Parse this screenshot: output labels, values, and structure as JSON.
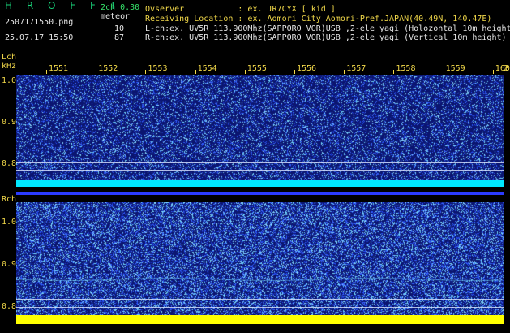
{
  "header": {
    "app_title": "H R O F F T",
    "channel_version": "2ch 0.30",
    "meteor_label": "meteor",
    "filename": "2507171550.png",
    "datetime": "25.07.17 15:50",
    "meteor_count_l": "10",
    "meteor_count_r": "87",
    "observer_line": "Ovserver           : ex. JR7CYX [ kid ]",
    "location_line": "Receiving Location : ex. Aomori City Aomori-Pref.JAPAN(40.49N, 140.47E)",
    "lch_line": "L-ch:ex. UV5R 113.900Mhz(SAPPORO VOR)USB ,2-ele yagi (Holozontal 10m height",
    "rch_line": "R-ch:ex. UV5R 113.900Mhz(SAPPORO VOR)USB ,2-ele yagi (Vertical 10m height)"
  },
  "lch": {
    "label": "Lch",
    "unit": "kHz",
    "yticks": [
      "1.0",
      "0.9",
      "0.8"
    ]
  },
  "rch": {
    "label": "Rch",
    "yticks": [
      "1.0",
      "0.9",
      "0.8"
    ]
  },
  "time_axis": {
    "labels": [
      "1551",
      "1552",
      "1553",
      "1554",
      "1555",
      "1556",
      "1557",
      "1558",
      "1559",
      "1600"
    ],
    "end_label": "2"
  },
  "colors": {
    "background": "#000000",
    "spectrogram_base": "#0b1570",
    "noise_blue": "#2a56ff",
    "noise_cyan": "#6fd8ff",
    "carrier_cyan": "#00e8ff",
    "carrier_yellow": "#ffff00",
    "label_yellow": "#f2d94a",
    "title_green": "#19d37a"
  }
}
